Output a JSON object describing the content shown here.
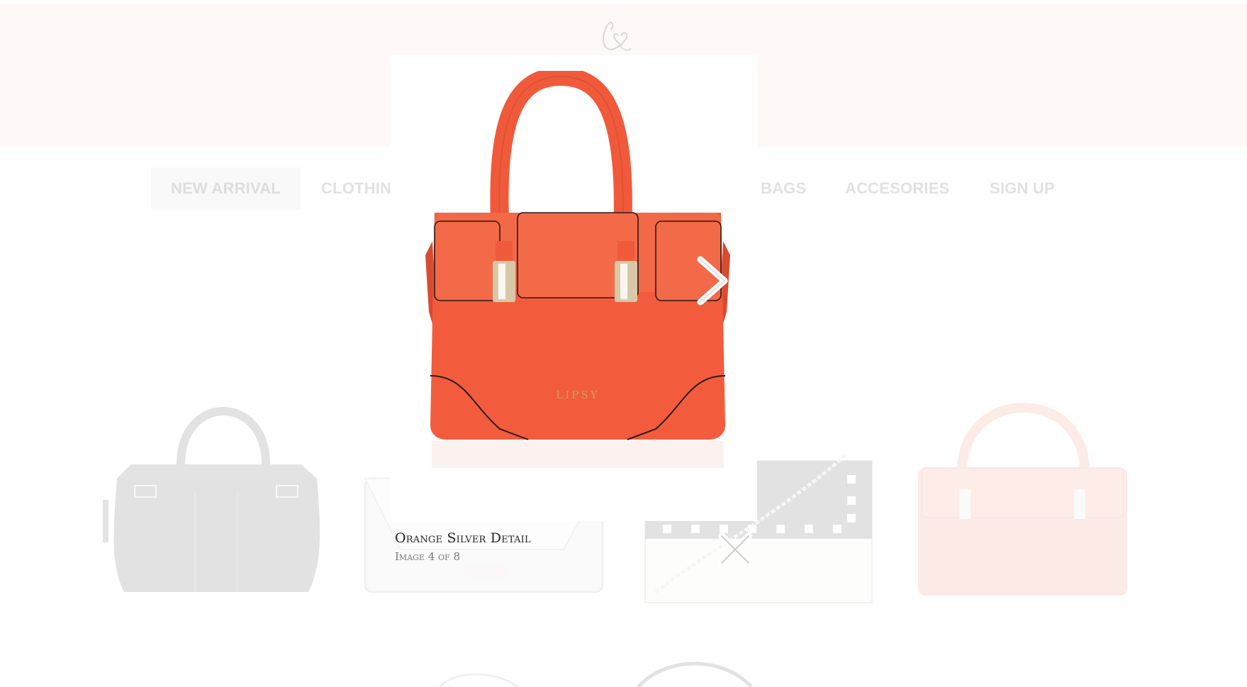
{
  "nav": {
    "items": [
      {
        "label": "NEW ARRIVAL",
        "active": true
      },
      {
        "label": "CLOTHIN"
      },
      {
        "label": "BAGS"
      },
      {
        "label": "ACCESORIES"
      },
      {
        "label": "SIGN UP"
      }
    ]
  },
  "logo": {
    "icon": "script-l-heart-logo"
  },
  "products": [
    {
      "icon": "black-handbag-image",
      "color": "#1a1a1a"
    },
    {
      "icon": "white-clutch-image",
      "color": "#e9e9e9"
    },
    {
      "icon": "studded-crossbody-bag-image",
      "color": "#222222"
    },
    {
      "icon": "orange-handbag-image",
      "color": "#f25c3c"
    }
  ],
  "lightbox": {
    "image_icon": "orange-handbag-image",
    "bag_brand": "LIPSY",
    "caption_title": "Orange Silver Detail",
    "caption_counter": "Image 4 of 8",
    "next_icon": "chevron-right-icon",
    "close_icon": "close-icon",
    "accent": "#f25c3c"
  }
}
